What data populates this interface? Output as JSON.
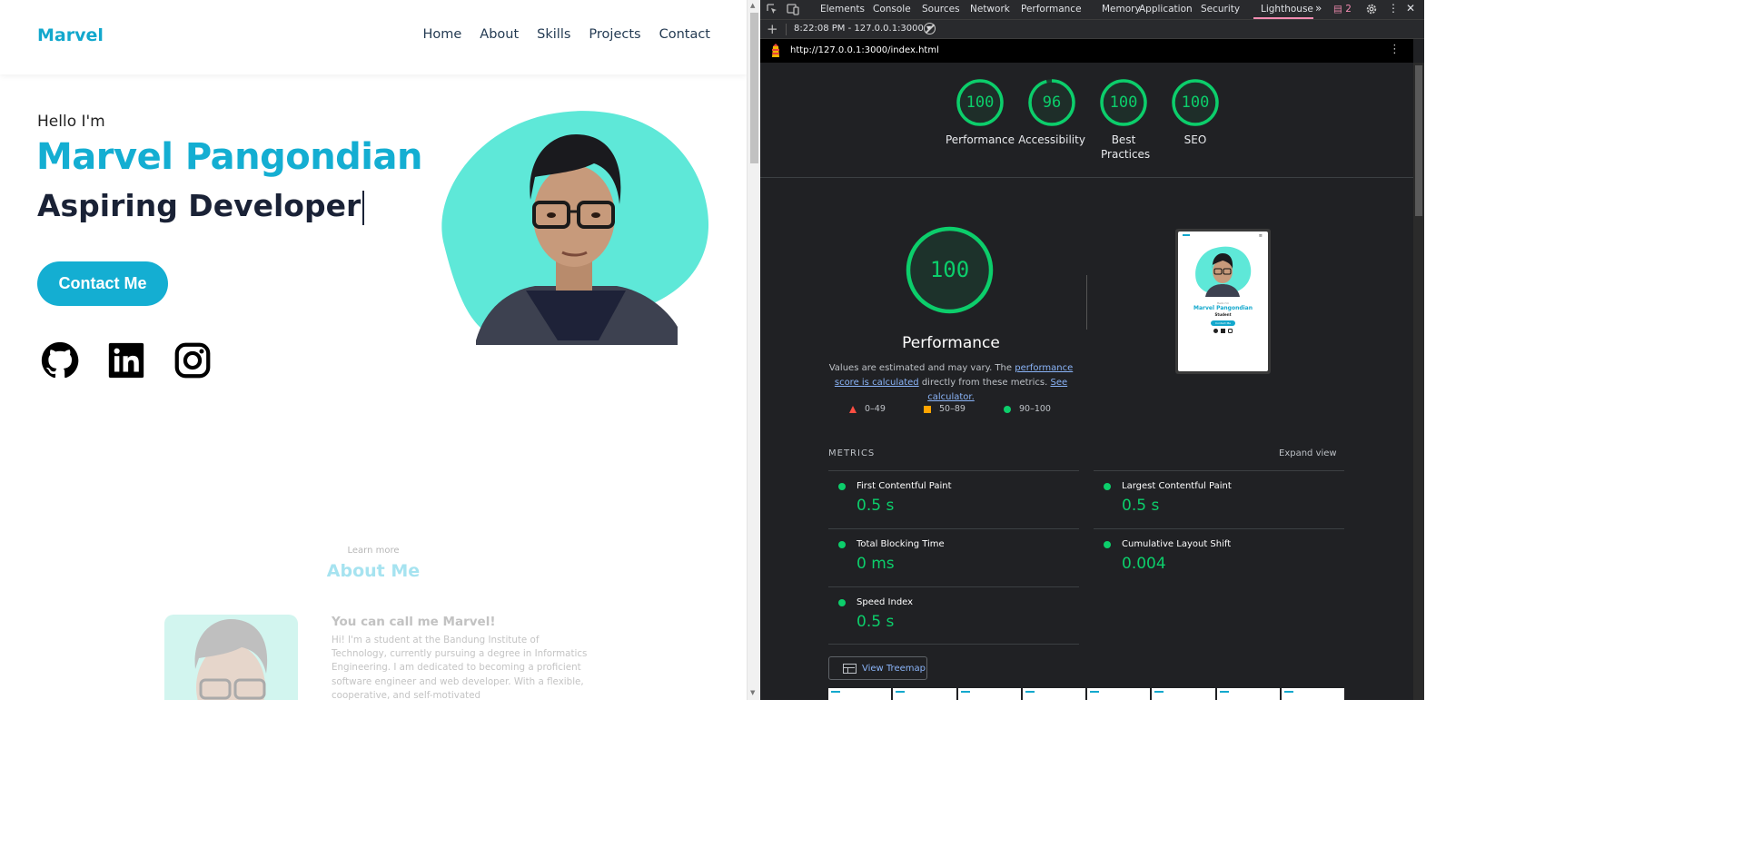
{
  "site": {
    "logo": "Marvel",
    "nav": [
      "Home",
      "About",
      "Skills",
      "Projects",
      "Contact"
    ],
    "hero": {
      "greeting": "Hello I'm",
      "name": "Marvel Pangondian",
      "role": "Aspiring Developer",
      "cta": "Contact Me"
    },
    "socials": [
      "github-icon",
      "linkedin-icon",
      "instagram-icon"
    ],
    "about": {
      "kicker": "Learn more",
      "title": "About Me",
      "subtitle": "You can call me Marvel!",
      "text": "Hi! I'm a student at the Bandung Institute of Technology, currently pursuing a degree in Informatics Engineering. I am dedicated to becoming a proficient software engineer and web developer. With a flexible, cooperative, and self-motivated"
    },
    "accent": "#14aed2",
    "blob_color": "#5ee8d8"
  },
  "devtools": {
    "tabs": [
      "Elements",
      "Console",
      "Sources",
      "Network",
      "Performance",
      "Memory",
      "Application",
      "Security",
      "Lighthouse"
    ],
    "active_tab": "Lighthouse",
    "issues_count": "2",
    "session": "8:22:08 PM - 127.0.0.1:3000 ▾",
    "url": "http://127.0.0.1:3000/index.html",
    "scores": [
      {
        "label": "Performance",
        "value": 100
      },
      {
        "label": "Accessibility",
        "value": 96
      },
      {
        "label": "Best Practices",
        "value": 100
      },
      {
        "label": "SEO",
        "value": 100
      }
    ],
    "big_score": {
      "label": "Performance",
      "value": 100
    },
    "desc": {
      "prefix": "Values are estimated and may vary. The ",
      "link1": "performance score is calculated",
      "middle": " directly from these metrics. ",
      "link2": "See calculator."
    },
    "legend": [
      "0–49",
      "50–89",
      "90–100"
    ],
    "metrics_header": "METRICS",
    "expand": "Expand view",
    "metrics": [
      {
        "name": "First Contentful Paint",
        "value": "0.5 s"
      },
      {
        "name": "Largest Contentful Paint",
        "value": "0.5 s"
      },
      {
        "name": "Total Blocking Time",
        "value": "0 ms"
      },
      {
        "name": "Cumulative Layout Shift",
        "value": "0.004"
      },
      {
        "name": "Speed Index",
        "value": "0.5 s"
      }
    ],
    "treemap": "View Treemap",
    "thumbnail_text": {
      "name": "Marvel Pangondian",
      "role": "Student",
      "cta": "Contact Me"
    },
    "colors": {
      "pass": "#0cce6b",
      "average": "#ffa400",
      "fail": "#ff4e42",
      "bg": "#202124"
    }
  }
}
